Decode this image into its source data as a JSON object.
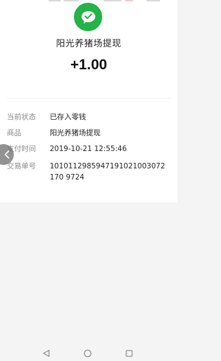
{
  "merchant_name": "阳光养猪场提现",
  "amount": "+1.00",
  "details": {
    "status": {
      "label": "当前状态",
      "value": "已存入零钱"
    },
    "product": {
      "label": "商品",
      "value": "阳光养猪场提现"
    },
    "pay_time": {
      "label": "支付时间",
      "value": "2019-10-21 12:55:46"
    },
    "transaction_no": {
      "label": "交易单号",
      "value": "1010112985947191021003072170 9724"
    }
  },
  "icons": {
    "logo": "wechat-pay-icon",
    "back_handle": "chevron-left-icon",
    "nav_back": "triangle-back-icon",
    "nav_home": "circle-home-icon",
    "nav_recent": "square-recent-icon"
  },
  "colors": {
    "brand_green": "#23b346"
  }
}
